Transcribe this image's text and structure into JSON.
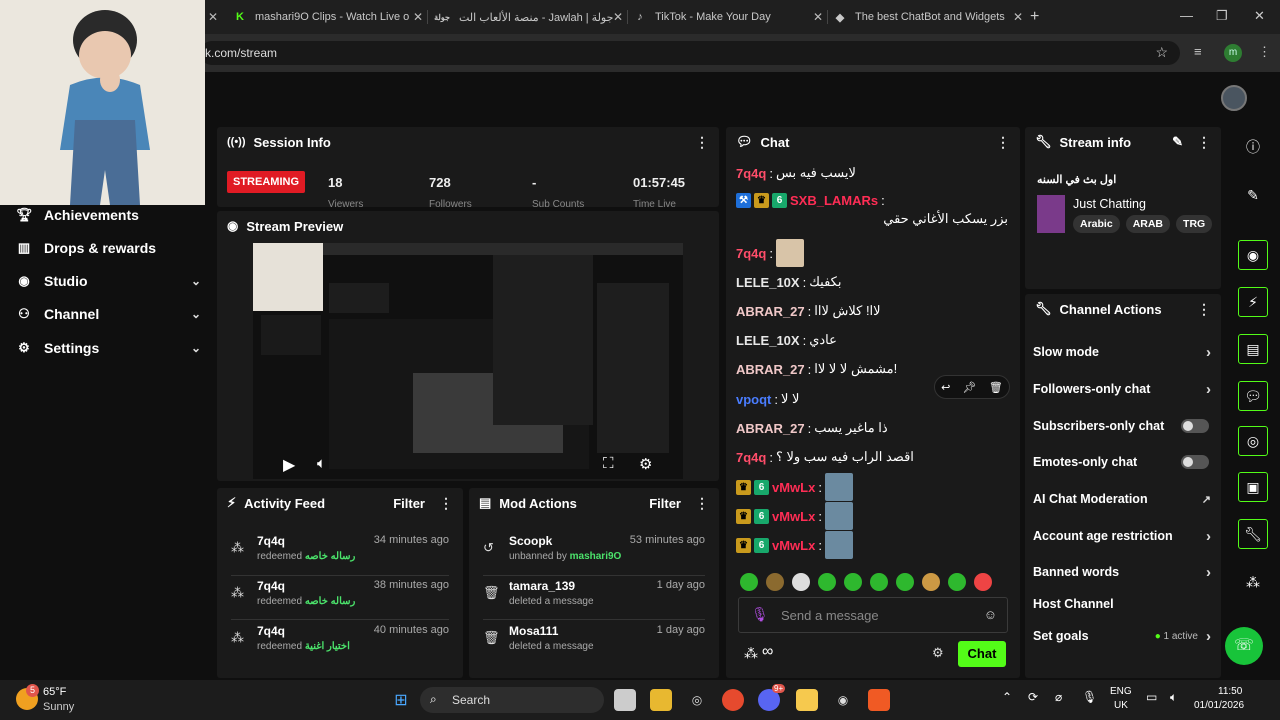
{
  "browser": {
    "tabs": [
      {
        "icon": "K",
        "title": "mashari9O Clips - Watch Live o"
      },
      {
        "icon": "جولة",
        "title": "منصة الألعاب الت - Jawlah | جولة"
      },
      {
        "icon": "♪",
        "title": "TikTok - Make Your Day"
      },
      {
        "icon": "◆",
        "title": "The best ChatBot and Widgets"
      }
    ],
    "url": "k.com/stream",
    "avatar_letter": "m"
  },
  "sidebar": {
    "items": [
      {
        "label": "Achievements",
        "icon": "trophy-icon"
      },
      {
        "label": "Drops & rewards",
        "icon": "gift-icon"
      },
      {
        "label": "Studio",
        "icon": "camera-icon"
      },
      {
        "label": "Channel",
        "icon": "people-icon"
      },
      {
        "label": "Settings",
        "icon": "gear-icon"
      }
    ]
  },
  "session": {
    "title": "Session Info",
    "status": "STREAMING",
    "viewers": "18",
    "viewers_label": "Viewers",
    "followers": "728",
    "followers_label": "Followers",
    "subs": "-",
    "subs_label": "Sub Counts",
    "time": "01:57:45",
    "time_label": "Time Live"
  },
  "preview": {
    "title": "Stream Preview"
  },
  "activity": {
    "title": "Activity Feed",
    "filter": "Filter",
    "rows": [
      {
        "name": "7q4q",
        "action": "redeemed",
        "reward": "رساله خاصه",
        "time": "34 minutes ago"
      },
      {
        "name": "7q4q",
        "action": "redeemed",
        "reward": "رساله خاصه",
        "time": "38 minutes ago"
      },
      {
        "name": "7q4q",
        "action": "redeemed",
        "reward": "اختيار اغنية",
        "time": "40 minutes ago"
      }
    ]
  },
  "mod": {
    "title": "Mod Actions",
    "filter": "Filter",
    "rows": [
      {
        "name": "Scoopk",
        "action": "unbanned by",
        "by": "mashari9O",
        "time": "53 minutes ago"
      },
      {
        "name": "tamara_139",
        "action": "deleted a message",
        "by": "",
        "time": "1 day ago"
      },
      {
        "name": "Mosa111",
        "action": "deleted a message",
        "by": "",
        "time": "1 day ago"
      }
    ]
  },
  "chat": {
    "title": "Chat",
    "messages": [
      {
        "user": "7q4q",
        "color": "#ff4d6a",
        "text": "لايسب فيه بس"
      },
      {
        "user": "SXB_LAMARs",
        "color": "#ff2d55",
        "text": "بزر يسكب الأغاني حقي"
      },
      {
        "user": "7q4q",
        "color": "#ff4d6a",
        "text": ""
      },
      {
        "user": "LELE_10X",
        "color": "#e8e8e8",
        "text": "بكفيك"
      },
      {
        "user": "ABRAR_27",
        "color": "#f0c8c8",
        "text": "لاا! كلاش لااا"
      },
      {
        "user": "LELE_10X",
        "color": "#e8e8e8",
        "text": "عادي"
      },
      {
        "user": "ABRAR_27",
        "color": "#f0c8c8",
        "text": "مشمش لا لا لاا!"
      },
      {
        "user": "vpoqt",
        "color": "#4a7dff",
        "text": "لا لا"
      },
      {
        "user": "ABRAR_27",
        "color": "#f0c8c8",
        "text": "ذا ماغير يسب"
      },
      {
        "user": "7q4q",
        "color": "#ff4d6a",
        "text": "اقصد الراب فيه سب ولا ؟"
      },
      {
        "user": "vMwLx",
        "color": "#ff2d55",
        "text": ""
      },
      {
        "user": "vMwLx",
        "color": "#ff2d55",
        "text": ""
      },
      {
        "user": "vMwLx",
        "color": "#ff2d55",
        "text": ""
      }
    ],
    "placeholder": "Send a message",
    "send": "Chat",
    "infinity": "∞"
  },
  "streaminfo": {
    "title": "Stream info",
    "stream_title": "اول بث في السنه",
    "category": "Just Chatting",
    "tags": [
      "Arabic",
      "ARAB",
      "TRG"
    ]
  },
  "actions": {
    "title": "Channel Actions",
    "items": [
      {
        "label": "Slow mode",
        "control": "arrow"
      },
      {
        "label": "Followers-only chat",
        "control": "arrow"
      },
      {
        "label": "Subscribers-only chat",
        "control": "toggle"
      },
      {
        "label": "Emotes-only chat",
        "control": "toggle"
      },
      {
        "label": "AI Chat Moderation",
        "control": "external"
      },
      {
        "label": "Account age restriction",
        "control": "arrow"
      },
      {
        "label": "Banned words",
        "control": "arrow"
      },
      {
        "label": "Host Channel",
        "control": "none"
      },
      {
        "label": "Set goals",
        "control": "arrow"
      }
    ],
    "goals_status": "1 active"
  },
  "taskbar": {
    "weather_temp": "65°F",
    "weather_desc": "Sunny",
    "weather_badge": "5",
    "search": "Search",
    "lang": "ENG",
    "region": "UK",
    "time": "11:50",
    "date": "01/01/2026",
    "discord_badge": "9+"
  },
  "colors": {
    "accent": "#53fc18",
    "live": "#e01b24"
  }
}
